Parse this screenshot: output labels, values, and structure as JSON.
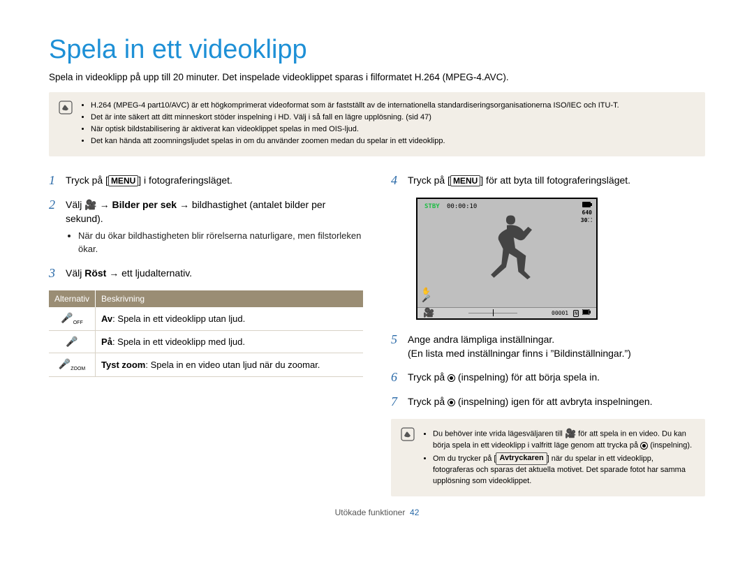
{
  "title": "Spela in ett videoklipp",
  "intro": "Spela in videoklipp på upp till 20 minuter. Det inspelade videoklippet sparas i filformatet H.264 (MPEG-4.AVC).",
  "topnote": {
    "items": [
      "H.264 (MPEG-4 part10/AVC) är ett högkomprimerat videoformat som är fastställt av de internationella standardiseringsorganisationerna ISO/IEC och ITU-T.",
      "Det är inte säkert att ditt minneskort stöder inspelning i HD. Välj i så fall en lägre upplösning. (sid 47)",
      "När optisk bildstabilisering är aktiverat kan videoklippet spelas in med OIS-ljud.",
      "Det kan hända att zoomningsljudet spelas in om du använder zoomen medan du spelar in ett videoklipp."
    ]
  },
  "menu_label": "MENU",
  "shutter_label": "Avtryckaren",
  "steps": {
    "s1": {
      "pre": "Tryck på [",
      "post": "] i fotograferingsläget."
    },
    "s2": {
      "pre": "Välj 🎥 ",
      "mid1": "Bilder per sek",
      "mid2": " bildhastighet (antalet bilder per sekund).",
      "bullet": "När du ökar bildhastigheten blir rörelserna naturligare, men filstorleken ökar."
    },
    "s3": {
      "pre": "Välj ",
      "bold": "Röst",
      "post": " ett ljudalternativ."
    },
    "s4": {
      "pre": "Tryck på [",
      "post": "] för att byta till fotograferingsläget."
    },
    "s5": {
      "l1": "Ange andra lämpliga inställningar.",
      "l2": "(En lista med inställningar finns i ”Bildinställningar.”)"
    },
    "s6": {
      "pre": "Tryck på ",
      "post": " (inspelning) för att börja spela in."
    },
    "s7": {
      "pre": "Tryck på ",
      "post": " (inspelning) igen för att avbryta inspelningen."
    }
  },
  "table": {
    "h1": "Alternativ",
    "h2": "Beskrivning",
    "rows": [
      {
        "icon": "mic-off",
        "b": "Av",
        "t": ": Spela in ett videoklipp utan ljud."
      },
      {
        "icon": "mic-on",
        "b": "På",
        "t": ": Spela in ett videoklipp med ljud."
      },
      {
        "icon": "mic-zoom",
        "b": "Tyst zoom",
        "t": ": Spela in en video utan ljud när du zoomar."
      }
    ]
  },
  "screen": {
    "stby": "STBY",
    "timecode": "00:00:10",
    "res": "640",
    "fps": "30",
    "counter": "00001",
    "mode": "🎥"
  },
  "bottomnote": {
    "item1_pre": "Du behöver inte vrida lägesväljaren till ",
    "item1_post": " för att spela in en video. Du kan börja spela in ett videoklipp i valfritt läge genom att trycka på ",
    "item1_end": " (inspelning).",
    "item2_pre": "Om du trycker på [",
    "item2_post": "] när du spelar in ett videoklipp, fotograferas och sparas det aktuella motivet. Det sparade fotot har samma upplösning som videoklippet."
  },
  "footer": {
    "text": "Utökade funktioner",
    "page": "42"
  }
}
